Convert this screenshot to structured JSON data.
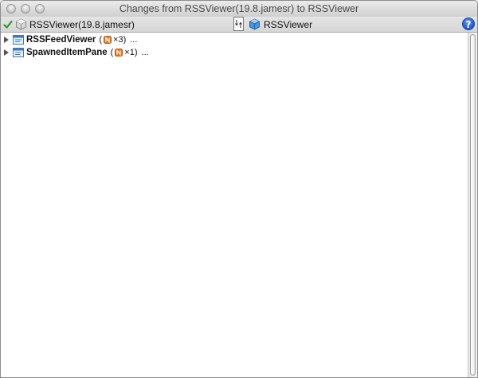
{
  "window": {
    "title": "Changes from RSSViewer(19.8.jamesr) to RSSViewer"
  },
  "toolbar": {
    "left_version": "RSSViewer(19.8.jamesr)",
    "right_version": "RSSViewer",
    "help_label": "?"
  },
  "tree": {
    "rows": [
      {
        "name": "RSSFeedViewer",
        "open_paren": "(",
        "count": "×3)",
        "ellipsis": "..."
      },
      {
        "name": "SpawnedItemPane",
        "open_paren": "(",
        "count": "×1)",
        "ellipsis": "..."
      }
    ]
  },
  "colors": {
    "accent_check": "#2a9b2a",
    "modified_icon": "#e8781e",
    "help_button": "#1f5fd8"
  }
}
